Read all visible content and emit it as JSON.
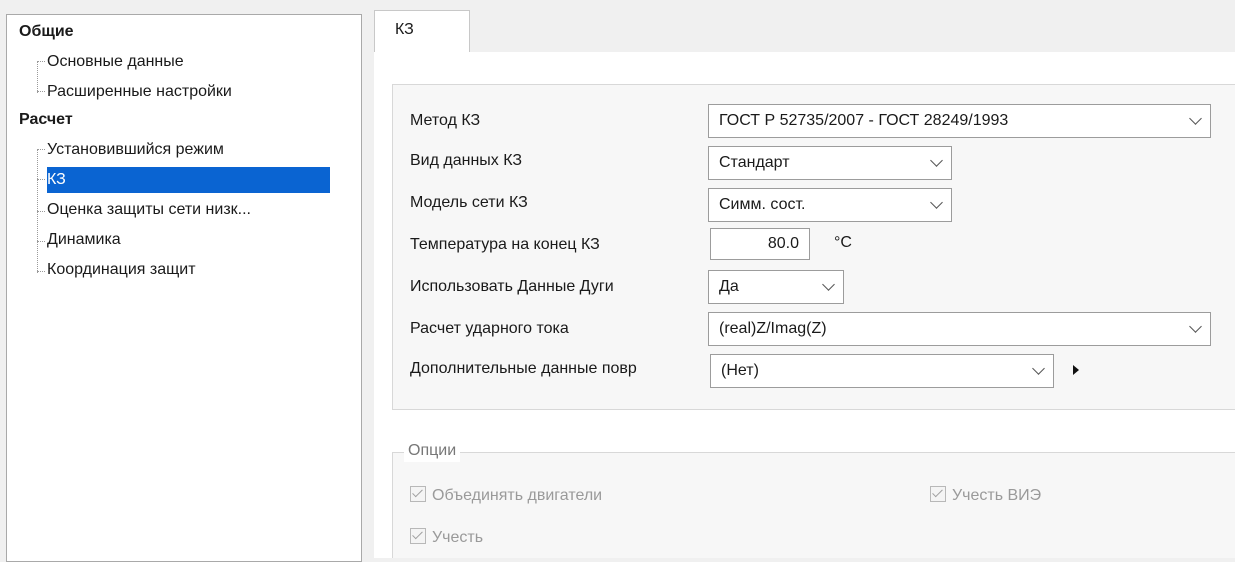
{
  "tree": {
    "groups": [
      {
        "label": "Общие",
        "items": [
          "Основные данные",
          "Расширенные настройки"
        ]
      },
      {
        "label": "Расчет",
        "items": [
          "Установившийся режим",
          "КЗ",
          "Оценка защиты сети низк...",
          "Динамика",
          "Координация защит"
        ]
      }
    ],
    "selected": "КЗ"
  },
  "tab": {
    "label": "КЗ"
  },
  "params": {
    "method": {
      "label": "Метод КЗ",
      "value": "ГОСТ Р 52735/2007 - ГОСТ 28249/1993"
    },
    "data_type": {
      "label": "Вид данных КЗ",
      "value": "Стандарт"
    },
    "network_model": {
      "label": "Модель сети КЗ",
      "value": "Симм. сост."
    },
    "temperature": {
      "label": "Температура на конец КЗ",
      "value": "80.0",
      "unit": "°C"
    },
    "arc_data": {
      "label": "Использовать Данные Дуги",
      "value": "Да"
    },
    "peak_current": {
      "label": "Расчет ударного тока",
      "value": "(real)Z/Imag(Z)"
    },
    "extra_fault": {
      "label": "Дополнительные данные повр",
      "value": "(Нет)"
    }
  },
  "options": {
    "title": "Опции",
    "merge_motors": {
      "label": "Объединять двигатели",
      "checked": true
    },
    "account_res": {
      "label": "Учесть ВИЭ",
      "checked": true
    },
    "account": {
      "label": "Учесть",
      "checked": true
    }
  },
  "colors": {
    "selection": "#0a64d2"
  }
}
